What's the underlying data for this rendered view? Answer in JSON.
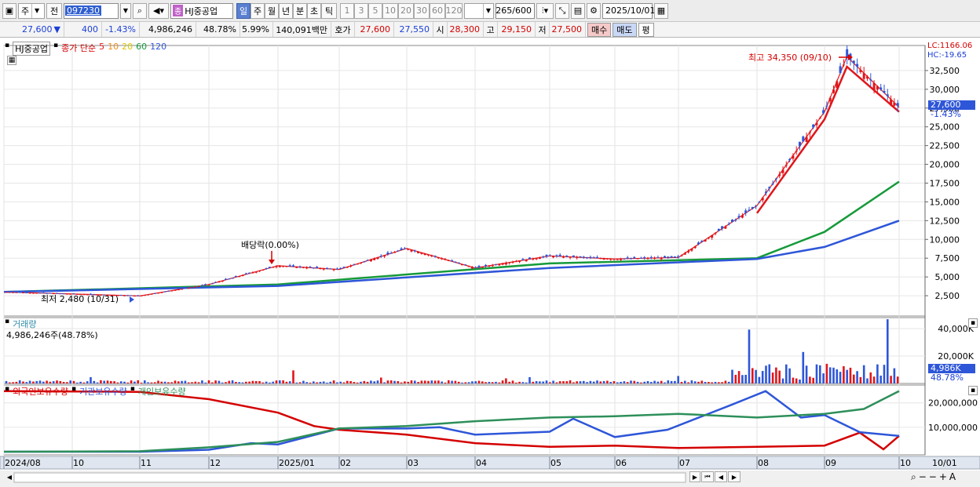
{
  "toolbar": {
    "market": "주",
    "prefix": "전",
    "code": "097230",
    "name_badge": "종",
    "name": "HJ중공업",
    "periods": [
      "일",
      "주",
      "월",
      "년",
      "분",
      "초",
      "틱"
    ],
    "active_period": "일",
    "intervals": [
      "1",
      "3",
      "5",
      "10",
      "20",
      "30",
      "60",
      "120"
    ],
    "count": "265",
    "count_total": "/600",
    "date": "2025/10/01"
  },
  "quote": {
    "price": "27,600",
    "arrow": "▼",
    "change": "400",
    "change_rate": "-1.43%",
    "volume": "4,986,246",
    "volume_rate": "48.78%",
    "turnover_rate": "5.99%",
    "amount": "140,091백만",
    "bid_ask_label": "호가",
    "ask": "27,600",
    "bid": "27,550",
    "open_label": "시",
    "open": "28,300",
    "high_label": "고",
    "high": "29,150",
    "low_label": "저",
    "low": "27,500",
    "buy_button": "매수",
    "sell_button": "매도",
    "eval_button": "평"
  },
  "price_panel": {
    "ticker": "HJ중공업",
    "legend_type": "종가 단순",
    "ma": [
      {
        "period": "5",
        "color": "#e0161b"
      },
      {
        "period": "10",
        "color": "#f28c1e"
      },
      {
        "period": "20",
        "color": "#f5e61a"
      },
      {
        "period": "60",
        "color": "#169a3a"
      },
      {
        "period": "120",
        "color": "#2e56d8"
      }
    ],
    "lc": "LC:1166.06",
    "hc": "HC:-19.65",
    "high_note": "최고 34,350 (09/10)",
    "low_note": "최저 2,480 (10/31)",
    "dividend_note": "배당락(0.00%)",
    "last_price": "27,600",
    "last_rate": "-1.43%",
    "y_ticks": [
      "32,500",
      "30,000",
      "27,500",
      "25,000",
      "22,500",
      "20,000",
      "17,500",
      "15,000",
      "12,500",
      "10,000",
      "7,500",
      "5,000",
      "2,500"
    ]
  },
  "volume_panel": {
    "title": "거래량",
    "value": "4,986,246주(48.78%)",
    "y_ticks": [
      "40,000K",
      "20,000K"
    ],
    "last": "4,986K",
    "last_rate": "48.78%"
  },
  "holding_panel": {
    "series": [
      {
        "name": "외국인보유수량",
        "color": "#d40000"
      },
      {
        "name": "기관보유수량",
        "color": "#2e56d8"
      },
      {
        "name": "개인보유수량",
        "color": "#2d8f5a"
      }
    ],
    "y_ticks": [
      "20,000,000",
      "10,000,000"
    ]
  },
  "x_axis": {
    "labels": [
      "2024/08",
      "10",
      "11",
      "12",
      "2025/01",
      "02",
      "03",
      "04",
      "05",
      "06",
      "07",
      "08",
      "09",
      "10"
    ],
    "right_label": "10/01"
  },
  "chart_data": {
    "type": "line",
    "title": "HJ중공업",
    "x_range": [
      "2024/08",
      "2025/10/01"
    ],
    "ylim": [
      0,
      35000
    ],
    "price_series": [
      {
        "name": "종가",
        "points": [
          [
            "2024/08",
            3000
          ],
          [
            "2024/10/31",
            2480
          ],
          [
            "2024/12",
            4000
          ],
          [
            "2025/01",
            6500
          ],
          [
            "2025/02",
            6000
          ],
          [
            "2025/03",
            8800
          ],
          [
            "2025/04",
            6200
          ],
          [
            "2025/05",
            7800
          ],
          [
            "2025/06",
            7400
          ],
          [
            "2025/07",
            7600
          ],
          [
            "2025/08",
            14500
          ],
          [
            "2025/09",
            27000
          ],
          [
            "2025/09/10",
            34350
          ],
          [
            "2025/10/01",
            27600
          ]
        ]
      },
      {
        "name": "5",
        "points": [
          [
            "2025/08",
            13500
          ],
          [
            "2025/09",
            26000
          ],
          [
            "2025/09/10",
            33000
          ],
          [
            "2025/10/01",
            27000
          ]
        ]
      },
      {
        "name": "60",
        "points": [
          [
            "2024/08",
            3000
          ],
          [
            "2025/01",
            4000
          ],
          [
            "2025/05",
            6800
          ],
          [
            "2025/08",
            7500
          ],
          [
            "2025/09",
            11000
          ],
          [
            "2025/10/01",
            17700
          ]
        ]
      },
      {
        "name": "120",
        "points": [
          [
            "2024/08",
            3000
          ],
          [
            "2025/01",
            3800
          ],
          [
            "2025/05",
            6200
          ],
          [
            "2025/08",
            7400
          ],
          [
            "2025/09",
            9000
          ],
          [
            "2025/10/01",
            12500
          ]
        ]
      }
    ]
  }
}
